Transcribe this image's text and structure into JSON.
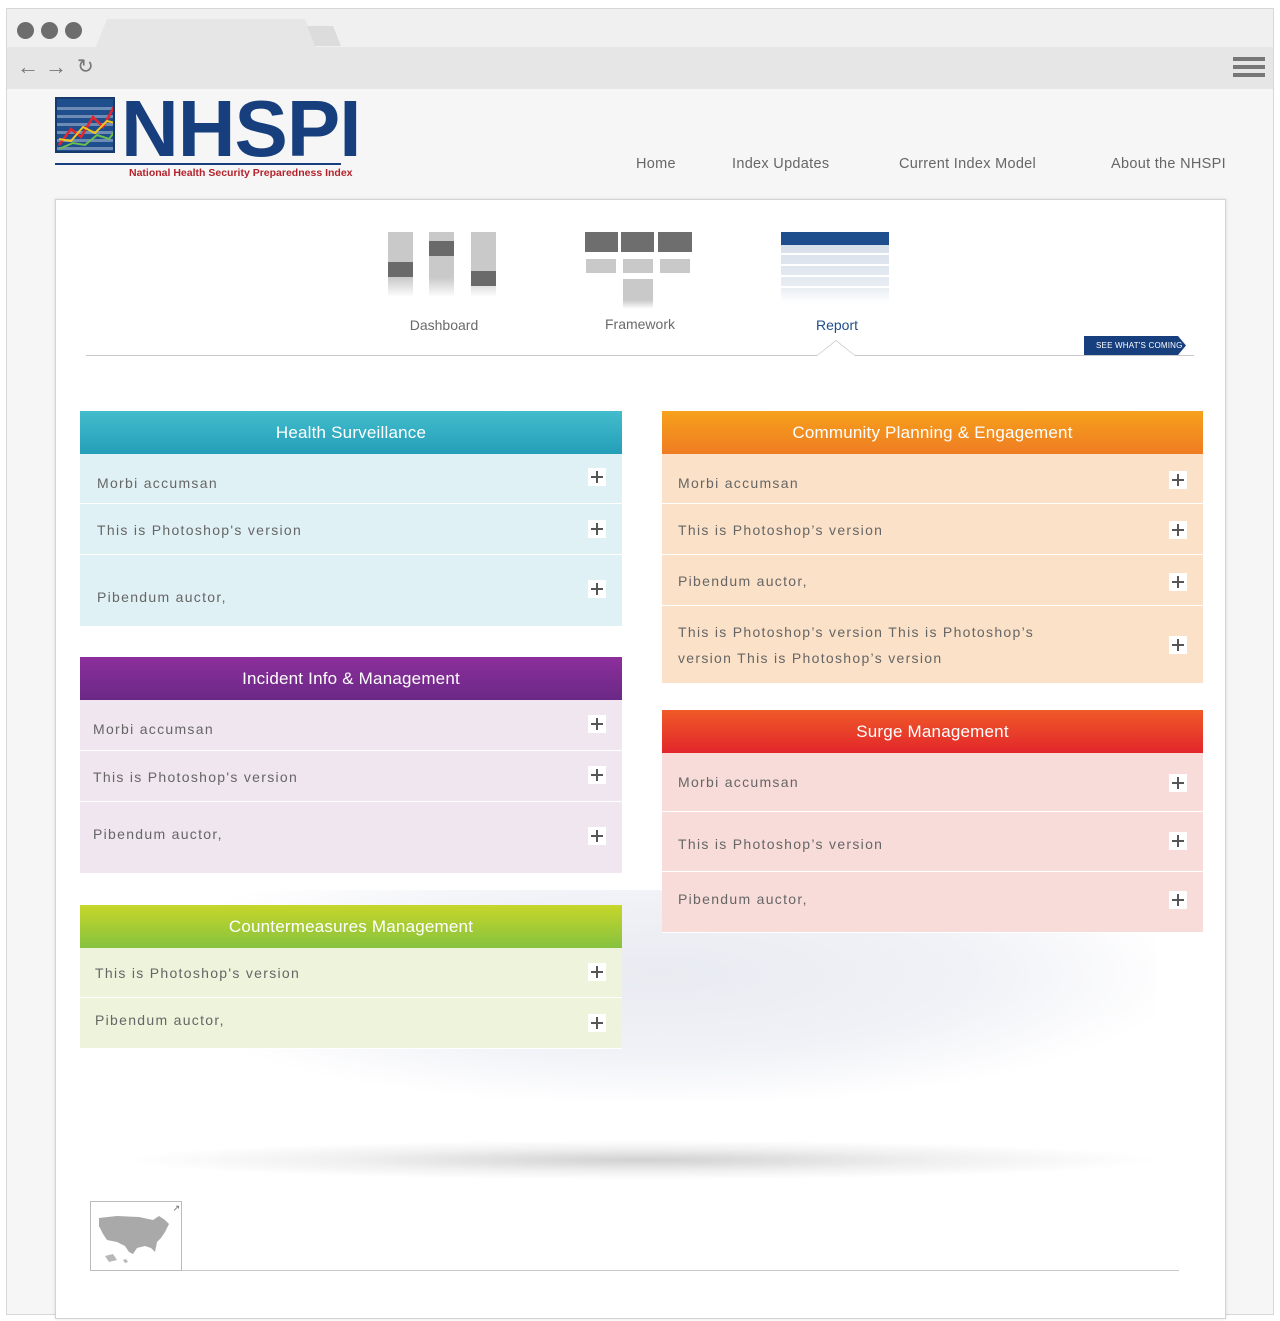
{
  "brand": {
    "name": "NHSPI",
    "tagline": "National Health Security Preparedness Index"
  },
  "topnav": {
    "home": "Home",
    "updates": "Index Updates",
    "model": "Current Index Model",
    "about": "About the NHSPI"
  },
  "views": {
    "dashboard": "Dashboard",
    "framework": "Framework",
    "report": "Report",
    "active": "Report",
    "coming": "SEE WHAT'S COMING"
  },
  "colors": {
    "surveillance": "#2fb1c4",
    "incident": "#7b2c91",
    "countermeasures": "#8cc63e",
    "community": "#f28a1f",
    "surge": "#e8322b",
    "brand": "#173f7d"
  },
  "panels": {
    "surveillance": {
      "title": "Health Surveillance",
      "rows": [
        "Morbi accumsan",
        "This is Photoshop's version",
        "Pibendum auctor,"
      ]
    },
    "incident": {
      "title": "Incident Info & Management",
      "rows": [
        "Morbi accumsan",
        "This is Photoshop's version",
        "Pibendum auctor,"
      ]
    },
    "countermeasures": {
      "title": "Countermeasures Management",
      "rows": [
        "This is Photoshop's version",
        "Pibendum auctor,"
      ]
    },
    "community": {
      "title": "Community Planning & Engagement",
      "rows": [
        "Morbi accumsan",
        "This is Photoshop’s version",
        "Pibendum auctor,",
        "This is Photoshop’s version This is Photoshop’s version This is Photoshop’s version"
      ]
    },
    "surge": {
      "title": "Surge Management",
      "rows": [
        "Morbi accumsan",
        "This is Photoshop’s version",
        "Pibendum auctor,"
      ]
    }
  }
}
